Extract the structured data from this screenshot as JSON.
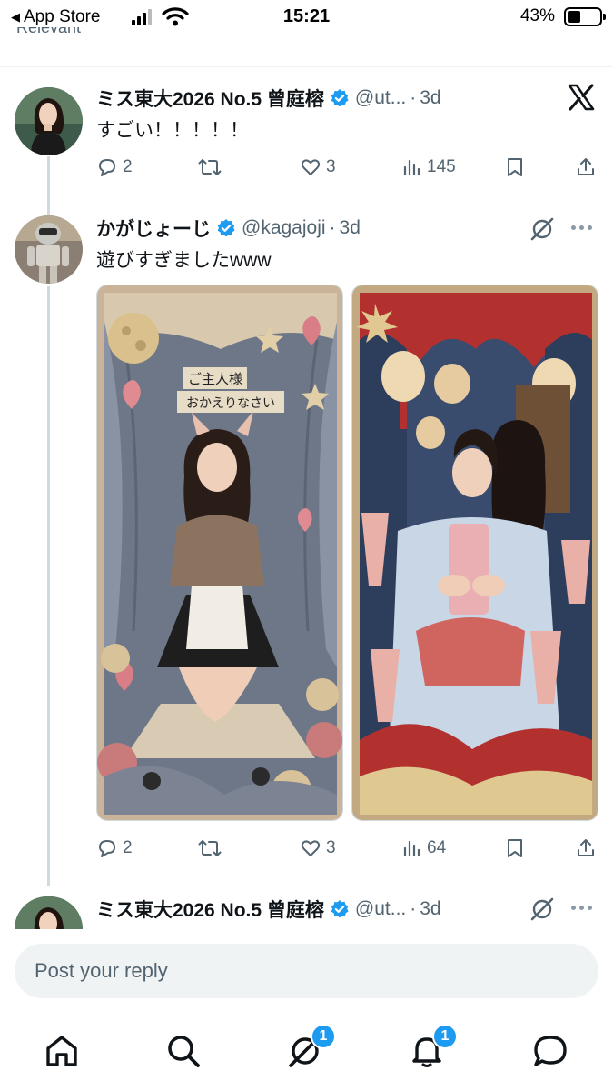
{
  "status_bar": {
    "back_label": "App Store",
    "time": "15:21",
    "battery": "43%"
  },
  "cut_off_text": "Relevant",
  "tweets": [
    {
      "name": "ミス東大2026 No.5 曾庭榕",
      "handle": "@ut...",
      "time": "3d",
      "text": "すごい！！！！！",
      "replies": "2",
      "reposts": "",
      "likes": "3",
      "views": "145"
    },
    {
      "name": "かがじょーじ",
      "handle": "@kagajoji",
      "time": "3d",
      "text": "遊びすぎましたwww",
      "media_left_sign": [
        "ご主人様",
        "おかえりなさい"
      ],
      "replies": "2",
      "reposts": "",
      "likes": "3",
      "views": "64"
    },
    {
      "name": "ミス東大2026 No.5 曾庭榕",
      "handle": "@ut...",
      "time": "3d"
    }
  ],
  "reply": {
    "placeholder": "Post your reply"
  },
  "nav": {
    "messages_badge": "1",
    "notifications_badge": "1"
  },
  "colors": {
    "accent": "#1d9bf0",
    "muted": "#536471",
    "text": "#0f1419",
    "divider": "#eff3f4"
  }
}
